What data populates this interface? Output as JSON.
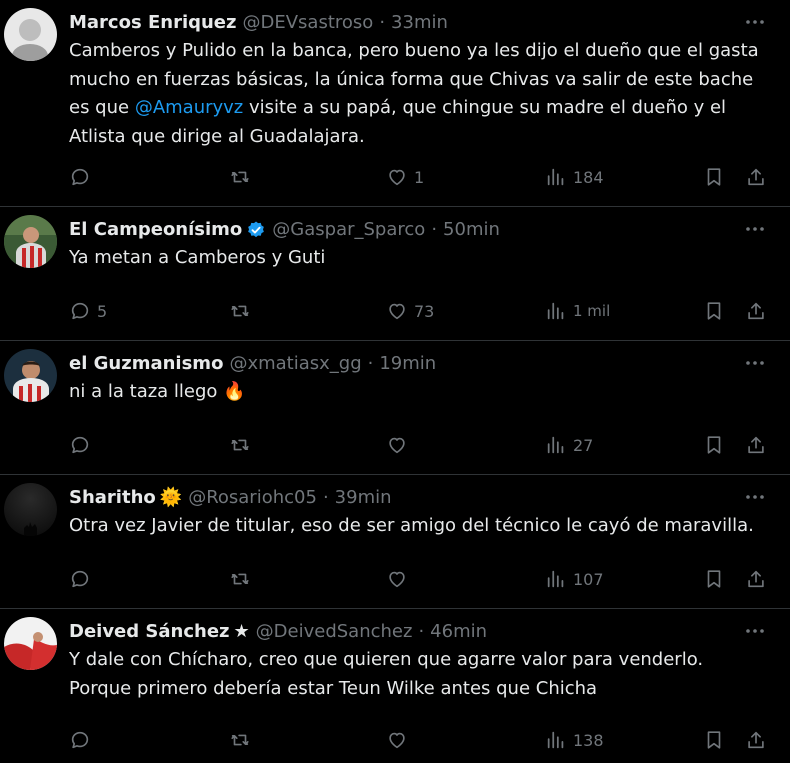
{
  "tweets": [
    {
      "name": "Marcos Enriquez",
      "handle": "@DEVsastroso",
      "sep": "·",
      "time": "33min",
      "text_before": "Camberos y Pulido en la banca, pero bueno ya les dijo el dueño que el gasta mucho en fuerzas básicas, la única forma que Chivas va salir de este bache es que ",
      "mention": "@Amauryvz",
      "text_after": " visite a su papá, que chingue su madre el dueño y el Atlista que dirige al Guadalajara.",
      "replies": "",
      "retweets": "",
      "likes": "1",
      "views": "184"
    },
    {
      "name": "El Campeonísimo",
      "handle": "@Gaspar_Sparco",
      "sep": "·",
      "time": "50min",
      "text": "Ya metan a Camberos y Guti",
      "replies": "5",
      "retweets": "",
      "likes": "73",
      "views": "1 mil"
    },
    {
      "name": "el Guzmanismo",
      "handle": "@xmatiasx_gg",
      "sep": "·",
      "time": "19min",
      "text": "ni a la taza llego 🔥",
      "replies": "",
      "retweets": "",
      "likes": "",
      "views": "27"
    },
    {
      "name": "Sharitho",
      "name_emoji": "🌞",
      "handle": "@Rosariohc05",
      "sep": "·",
      "time": "39min",
      "text": "Otra vez Javier de titular, eso de ser amigo del técnico le cayó de maravilla.",
      "replies": "",
      "retweets": "",
      "likes": "",
      "views": "107"
    },
    {
      "name": "Deived Sánchez",
      "name_emoji": "★",
      "handle": "@DeivedSanchez",
      "sep": "·",
      "time": "46min",
      "text": "Y dale con Chícharo, creo que quieren que agarre valor para venderlo. Porque primero debería estar Teun Wilke antes que Chicha",
      "replies": "",
      "retweets": "",
      "likes": "",
      "views": "138"
    }
  ],
  "colors": {
    "background": "#000000",
    "text": "#e7e9ea",
    "muted": "#71767b",
    "link": "#1d9bf0",
    "divider": "#2f3336",
    "verified": "#1d9bf0"
  },
  "icons": [
    "reply-icon",
    "retweet-icon",
    "like-icon",
    "views-icon",
    "bookmark-icon",
    "share-icon",
    "more-icon",
    "verified-badge-icon"
  ]
}
